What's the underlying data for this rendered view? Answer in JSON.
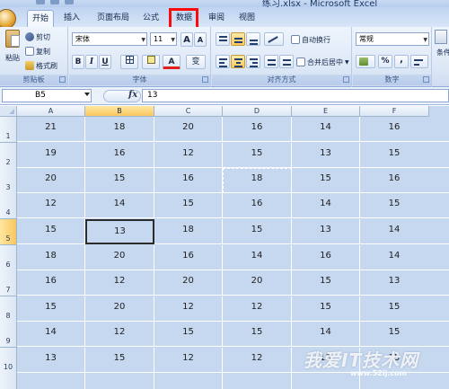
{
  "window": {
    "title": "练习.xlsx - Microsoft Excel"
  },
  "tabs": [
    {
      "label": "开始",
      "active": true
    },
    {
      "label": "插入",
      "active": false
    },
    {
      "label": "页面布局",
      "active": false
    },
    {
      "label": "公式",
      "active": false
    },
    {
      "label": "数据",
      "active": false,
      "highlighted": true
    },
    {
      "label": "审阅",
      "active": false
    },
    {
      "label": "视图",
      "active": false
    }
  ],
  "ribbon": {
    "clipboard": {
      "label": "剪贴板",
      "paste": "粘贴",
      "cut": "剪切",
      "copy": "复制",
      "format_painter": "格式刷"
    },
    "font": {
      "label": "字体",
      "name": "宋体",
      "size": "11",
      "grow": "A",
      "shrink": "A",
      "bold": "B",
      "italic": "I",
      "underline": "U",
      "font_color": "A",
      "phonetic": "变"
    },
    "alignment": {
      "label": "对齐方式",
      "wrap_text": "自动换行",
      "merge_center": "合并后居中"
    },
    "number": {
      "label": "数字",
      "format": "常规",
      "percent": "%",
      "comma": ","
    },
    "styles": {
      "label": "条件"
    }
  },
  "formula_bar": {
    "name_box": "B5",
    "fx": "fx",
    "value": "13"
  },
  "sheet": {
    "columns": [
      "A",
      "B",
      "C",
      "D",
      "E",
      "F"
    ],
    "selected_column": "B",
    "selected_row": "5",
    "active_cell": "B5",
    "copy_marquee_cell": "D3",
    "rows": [
      {
        "num": "1",
        "cells": [
          "21",
          "18",
          "20",
          "16",
          "14",
          "16"
        ]
      },
      {
        "num": "2",
        "cells": [
          "19",
          "16",
          "12",
          "15",
          "13",
          "15"
        ]
      },
      {
        "num": "3",
        "cells": [
          "20",
          "15",
          "16",
          "18",
          "15",
          "16"
        ]
      },
      {
        "num": "4",
        "cells": [
          "12",
          "14",
          "15",
          "16",
          "14",
          "15"
        ]
      },
      {
        "num": "5",
        "cells": [
          "15",
          "13",
          "18",
          "15",
          "13",
          "14"
        ]
      },
      {
        "num": "6",
        "cells": [
          "18",
          "20",
          "16",
          "14",
          "16",
          "14"
        ]
      },
      {
        "num": "7",
        "cells": [
          "16",
          "12",
          "20",
          "20",
          "15",
          "13"
        ]
      },
      {
        "num": "8",
        "cells": [
          "15",
          "20",
          "12",
          "12",
          "15",
          "15"
        ]
      },
      {
        "num": "9",
        "cells": [
          "14",
          "12",
          "15",
          "15",
          "14",
          "15"
        ]
      },
      {
        "num": "10",
        "cells": [
          "13",
          "15",
          "12",
          "12",
          "13",
          "15"
        ]
      },
      {
        "num": "",
        "cells": [
          "",
          "",
          "",
          "",
          "",
          ""
        ]
      }
    ]
  },
  "watermark": {
    "text": "我爱IT技术网",
    "url": "www.52ij.com"
  },
  "colors": {
    "highlight": "#ff0a0a",
    "cell_fill": "#c6d8ef",
    "header_selected": "#f8c75e"
  }
}
